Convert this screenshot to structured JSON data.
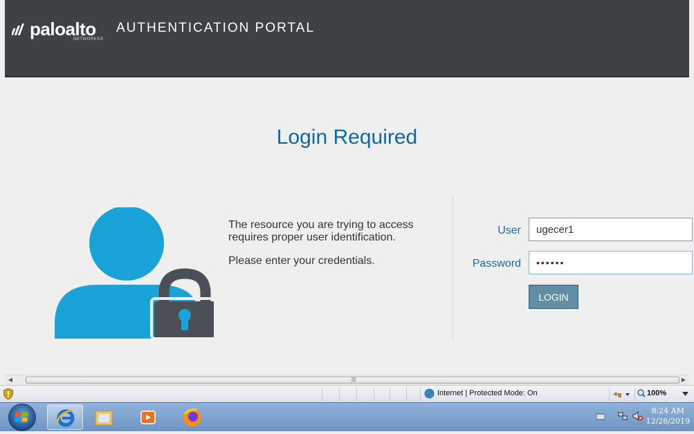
{
  "header": {
    "logo_word": "paloalto",
    "logo_sub": "NETWORKS®",
    "portal_title": "AUTHENTICATION PORTAL"
  },
  "main": {
    "title": "Login Required",
    "message_line1": "The resource you are trying to access requires proper user identification.",
    "message_line2": "Please enter your credentials.",
    "user_label": "User",
    "user_value": "ugecer1",
    "password_label": "Password",
    "password_value": "••••••",
    "login_label": "LOGIN"
  },
  "statusbar": {
    "zone": "Internet | Protected Mode: On",
    "zoom": "100%"
  },
  "taskbar": {
    "time": "8:24 AM",
    "date": "12/26/2019"
  },
  "colors": {
    "header": "#3d4245",
    "title": "#0b6aa2",
    "illustration": "#1aa3d7",
    "lock": "#4a5055",
    "button": "#5f8ea5"
  }
}
